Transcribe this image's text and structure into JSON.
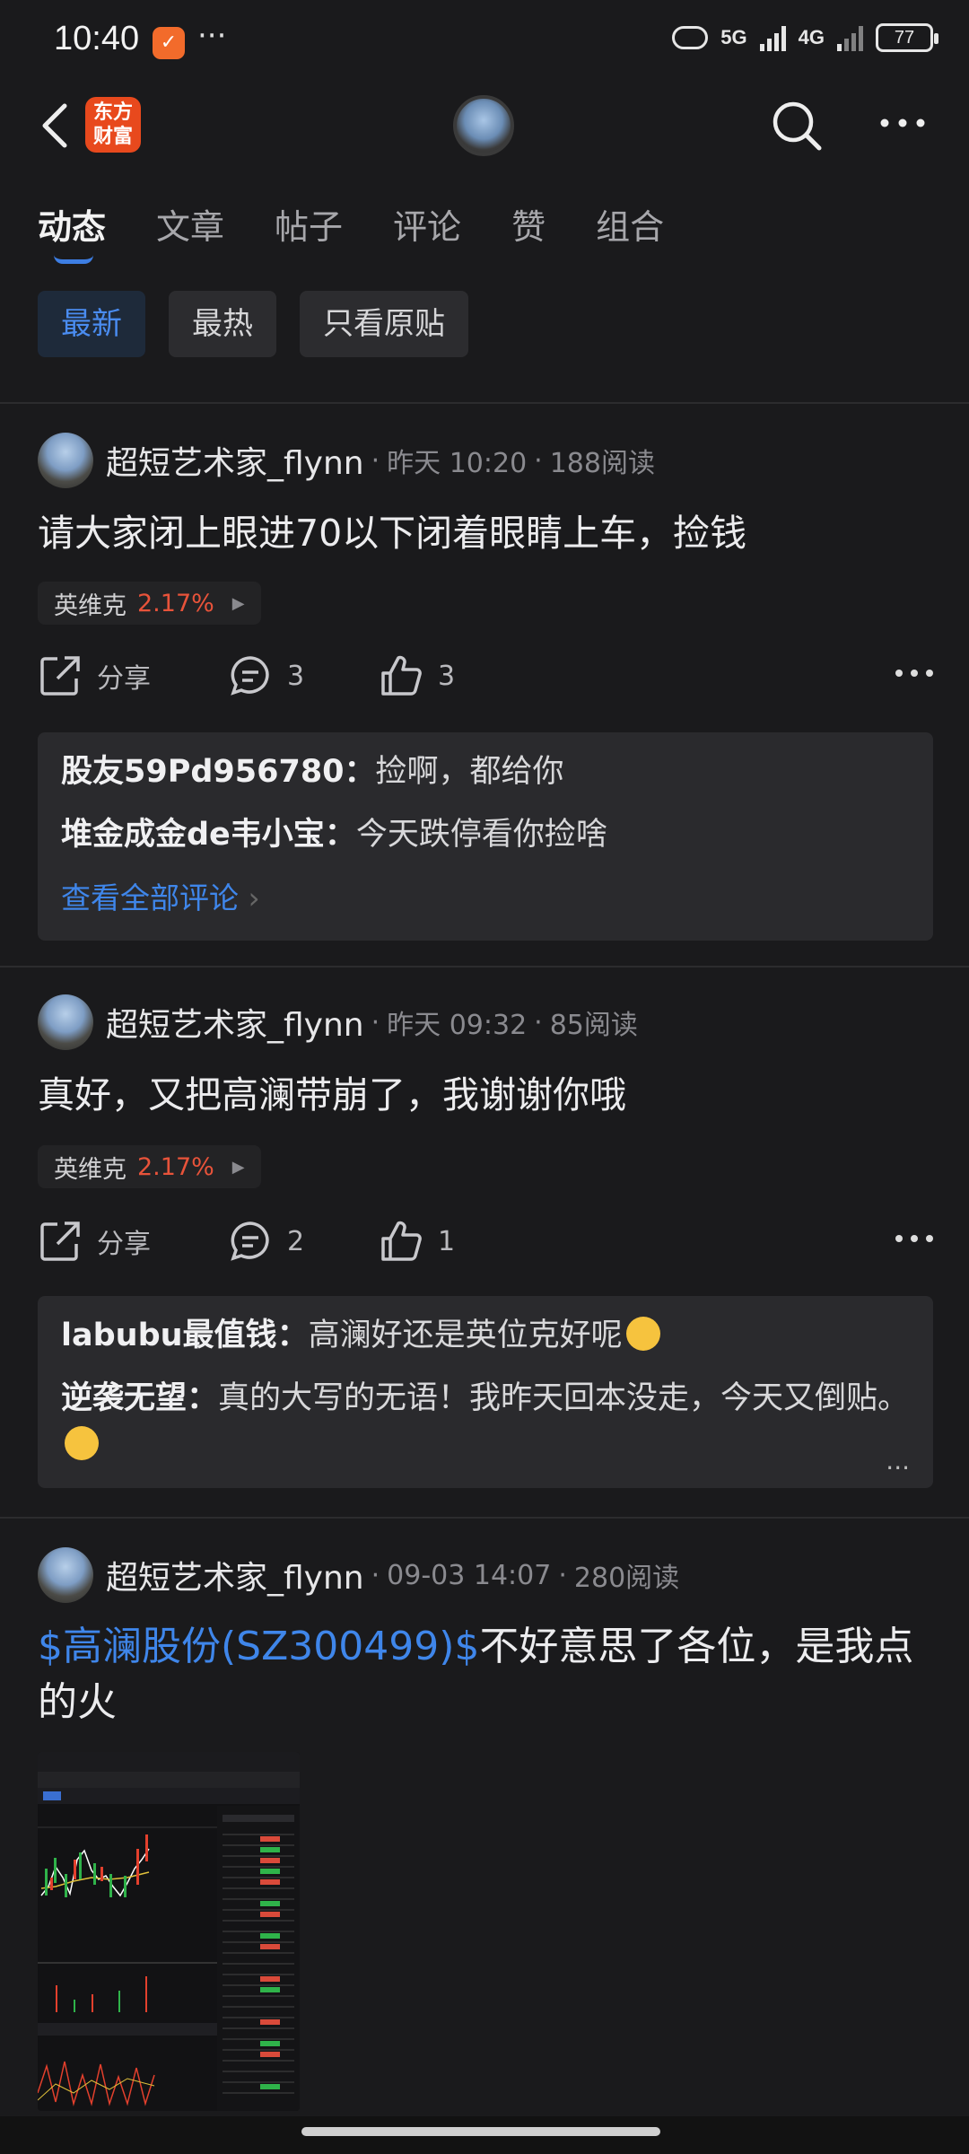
{
  "status": {
    "time": "10:40",
    "net1": "5G",
    "net2": "4G",
    "battery": "77"
  },
  "nav": {
    "logo_text": "东方财富"
  },
  "tabs": [
    "动态",
    "文章",
    "帖子",
    "评论",
    "赞",
    "组合"
  ],
  "filters": [
    "最新",
    "最热",
    "只看原贴"
  ],
  "posts": [
    {
      "author": "超短艺术家_flynn",
      "time": "昨天 10:20",
      "reads": "188阅读",
      "text": "请大家闭上眼进70以下闭着眼睛上车，捡钱",
      "stock": {
        "name": "英维克",
        "pct": "2.17%"
      },
      "share": "分享",
      "comments": "3",
      "likes": "3",
      "replies": [
        {
          "user": "股友59Pd956780",
          "text": "捡啊，都给你"
        },
        {
          "user": "堆金成金de韦小宝",
          "text": "今天跌停看你捡啥"
        }
      ],
      "see_all": "查看全部评论"
    },
    {
      "author": "超短艺术家_flynn",
      "time": "昨天 09:32",
      "reads": "85阅读",
      "text": "真好，又把高澜带崩了，我谢谢你哦",
      "stock": {
        "name": "英维克",
        "pct": "2.17%"
      },
      "share": "分享",
      "comments": "2",
      "likes": "1",
      "replies": [
        {
          "user": "labubu最值钱",
          "text": "高澜好还是英位克好呢"
        },
        {
          "user": "逆袭无望",
          "text": "真的大写的无语！我昨天回本没走，今天又倒贴。"
        }
      ],
      "more": "..."
    },
    {
      "author": "超短艺术家_flynn",
      "time": "09-03 14:07",
      "reads": "280阅读",
      "tag": "$高澜股份(SZ300499)$",
      "text": "不好意思了各位，是我点的火"
    }
  ]
}
